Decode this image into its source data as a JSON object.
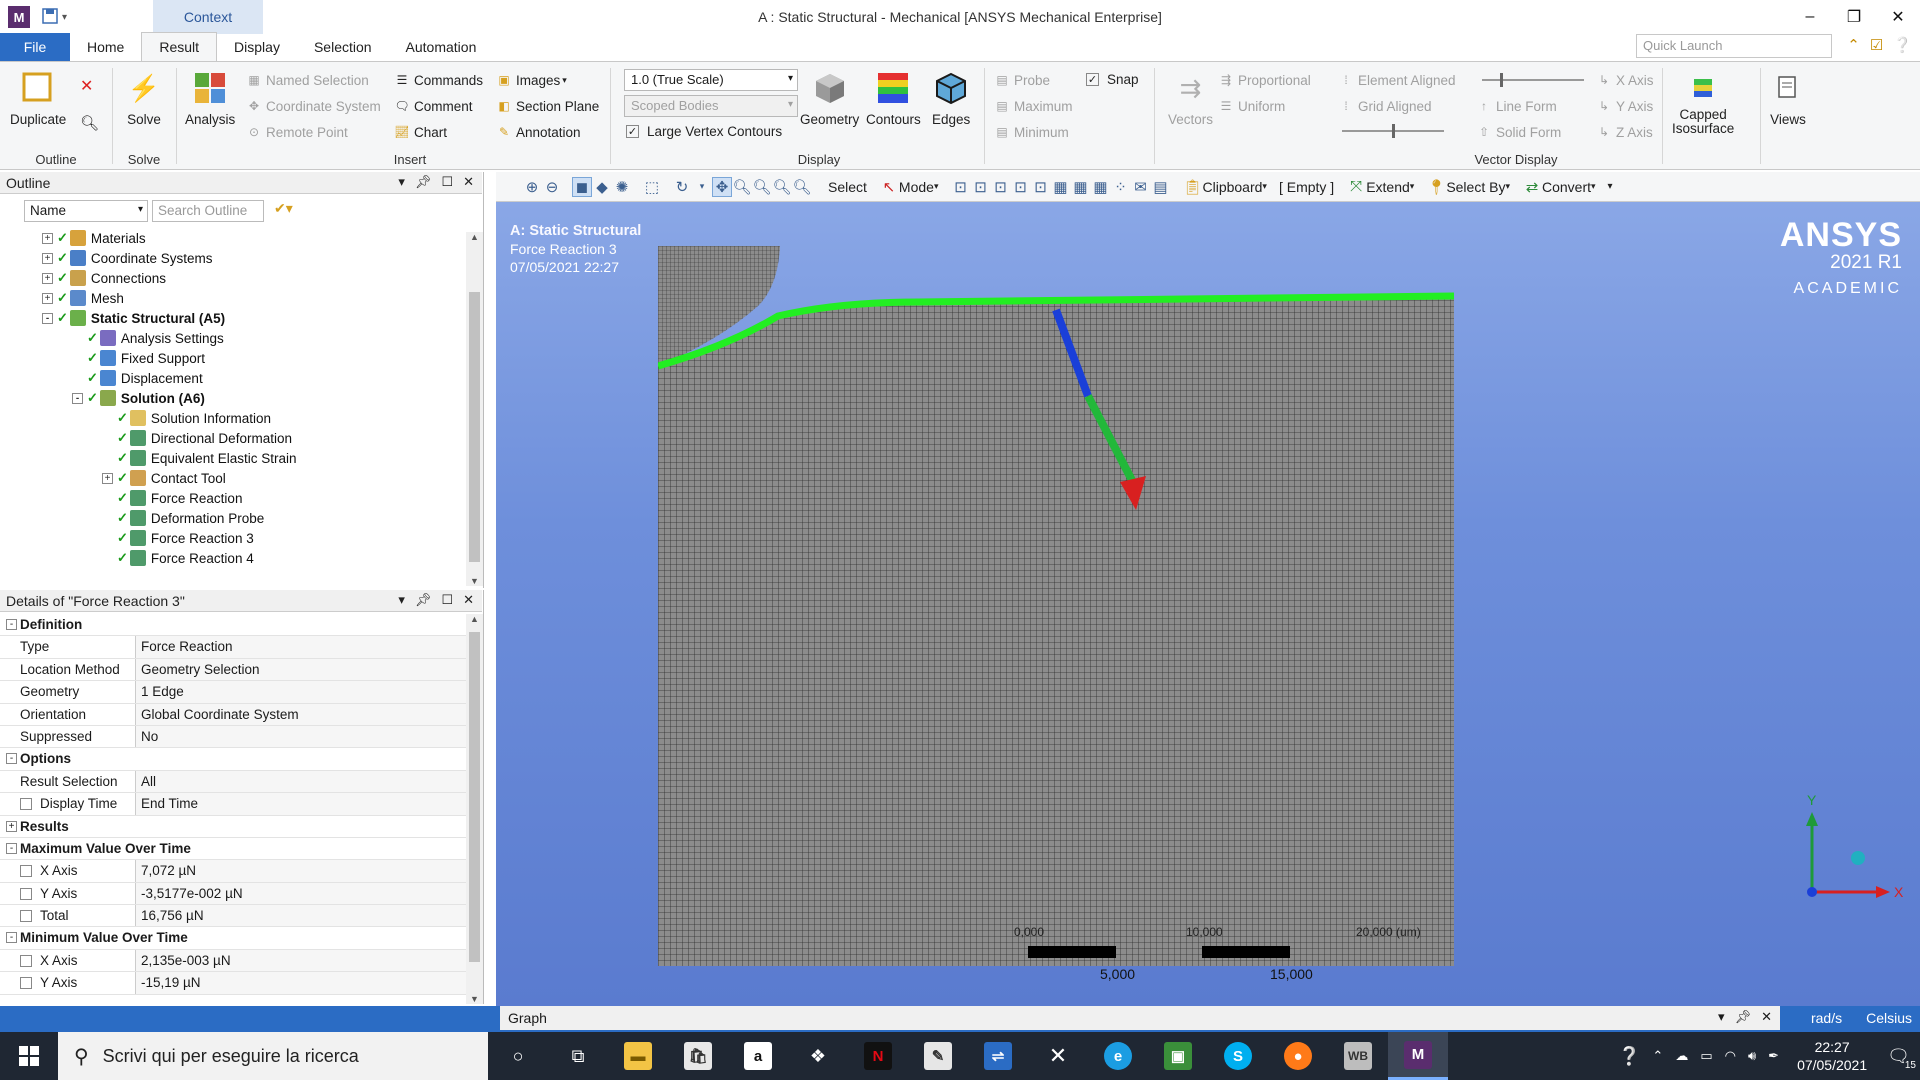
{
  "window": {
    "app_letter": "M",
    "context_tab": "Context",
    "title": "A : Static Structural - Mechanical [ANSYS Mechanical Enterprise]"
  },
  "tabs": [
    "File",
    "Home",
    "Result",
    "Display",
    "Selection",
    "Automation"
  ],
  "active_tab": "Result",
  "quick_launch_placeholder": "Quick Launch",
  "ribbon": {
    "outline": {
      "label": "Outline",
      "duplicate": "Duplicate"
    },
    "solve": {
      "label": "Solve",
      "group": "Solve"
    },
    "analysis": {
      "label": "Analysis"
    },
    "insert": {
      "label": "Insert",
      "named_selection": "Named Selection",
      "coordinate_system": "Coordinate System",
      "remote_point": "Remote Point",
      "commands": "Commands",
      "comment": "Comment",
      "chart": "Chart",
      "images": "Images",
      "section_plane": "Section Plane",
      "annotation": "Annotation"
    },
    "display": {
      "label": "Display",
      "scale": "1.0 (True Scale)",
      "scoped": "Scoped Bodies",
      "large_vertex": "Large Vertex Contours",
      "geometry": "Geometry",
      "contours": "Contours",
      "edges": "Edges",
      "probe": "Probe",
      "maximum": "Maximum",
      "minimum": "Minimum",
      "snap": "Snap"
    },
    "vector_display": {
      "label": "Vector Display",
      "vectors": "Vectors",
      "proportional": "Proportional",
      "uniform": "Uniform",
      "element_aligned": "Element Aligned",
      "grid_aligned": "Grid Aligned",
      "line_form": "Line Form",
      "solid_form": "Solid Form",
      "x_axis": "X Axis",
      "y_axis": "Y Axis",
      "z_axis": "Z Axis"
    },
    "capped_isosurface": "Capped\nIsosurface",
    "views": "Views"
  },
  "outline": {
    "title": "Outline",
    "filter": "Name",
    "search_placeholder": "Search Outline",
    "tree": [
      {
        "label": "Materials",
        "level": 1,
        "expander": "+",
        "icon": "#d7a23c",
        "bold": false
      },
      {
        "label": "Coordinate Systems",
        "level": 1,
        "expander": "+",
        "icon": "#4a7fc7",
        "bold": false
      },
      {
        "label": "Connections",
        "level": 1,
        "expander": "+",
        "icon": "#c9a14c",
        "bold": false
      },
      {
        "label": "Mesh",
        "level": 1,
        "expander": "+",
        "icon": "#5b8acb",
        "bold": false
      },
      {
        "label": "Static Structural (A5)",
        "level": 1,
        "expander": "-",
        "icon": "#6bb04a",
        "bold": true
      },
      {
        "label": "Analysis Settings",
        "level": 2,
        "expander": "",
        "icon": "#7a6cc0",
        "bold": false
      },
      {
        "label": "Fixed Support",
        "level": 2,
        "expander": "",
        "icon": "#4a86d1",
        "bold": false
      },
      {
        "label": "Displacement",
        "level": 2,
        "expander": "",
        "icon": "#4a86d1",
        "bold": false
      },
      {
        "label": "Solution (A6)",
        "level": 2,
        "expander": "-",
        "icon": "#8aa84c",
        "bold": true
      },
      {
        "label": "Solution Information",
        "level": 3,
        "expander": "",
        "icon": "#e0c060",
        "bold": false
      },
      {
        "label": "Directional Deformation",
        "level": 3,
        "expander": "",
        "icon": "#4f9a6a",
        "bold": false
      },
      {
        "label": "Equivalent Elastic Strain",
        "level": 3,
        "expander": "",
        "icon": "#4f9a6a",
        "bold": false
      },
      {
        "label": "Contact Tool",
        "level": 3,
        "expander": "+",
        "icon": "#d0a050",
        "bold": false
      },
      {
        "label": "Force Reaction",
        "level": 3,
        "expander": "",
        "icon": "#4f9a6a",
        "bold": false
      },
      {
        "label": "Deformation Probe",
        "level": 3,
        "expander": "",
        "icon": "#4f9a6a",
        "bold": false
      },
      {
        "label": "Force Reaction 3",
        "level": 3,
        "expander": "",
        "icon": "#4f9a6a",
        "bold": false
      },
      {
        "label": "Force Reaction 4",
        "level": 3,
        "expander": "",
        "icon": "#4f9a6a",
        "bold": false
      }
    ]
  },
  "details": {
    "title": "Details of \"Force Reaction 3\"",
    "rows": [
      {
        "kind": "section",
        "key": "Definition",
        "toggle": "-"
      },
      {
        "kind": "row",
        "key": "Type",
        "value": "Force Reaction",
        "cb": false
      },
      {
        "kind": "row",
        "key": "Location Method",
        "value": "Geometry Selection",
        "cb": false
      },
      {
        "kind": "row",
        "key": "Geometry",
        "value": "1 Edge",
        "cb": false
      },
      {
        "kind": "row",
        "key": "Orientation",
        "value": "Global Coordinate System",
        "cb": false
      },
      {
        "kind": "row",
        "key": "Suppressed",
        "value": "No",
        "cb": false
      },
      {
        "kind": "section",
        "key": "Options",
        "toggle": "-"
      },
      {
        "kind": "row",
        "key": "Result Selection",
        "value": "All",
        "cb": false
      },
      {
        "kind": "row",
        "key": "Display Time",
        "value": "End Time",
        "cb": true
      },
      {
        "kind": "section",
        "key": "Results",
        "toggle": "+"
      },
      {
        "kind": "section",
        "key": "Maximum Value Over Time",
        "toggle": "-"
      },
      {
        "kind": "row",
        "key": "X Axis",
        "value": "7,072 µN",
        "cb": true
      },
      {
        "kind": "row",
        "key": "Y Axis",
        "value": "-3,5177e-002 µN",
        "cb": true
      },
      {
        "kind": "row",
        "key": "Total",
        "value": "16,756 µN",
        "cb": true
      },
      {
        "kind": "section",
        "key": "Minimum Value Over Time",
        "toggle": "-"
      },
      {
        "kind": "row",
        "key": "X Axis",
        "value": "2,135e-003 µN",
        "cb": true
      },
      {
        "kind": "row",
        "key": "Y Axis",
        "value": "-15,19 µN",
        "cb": true
      }
    ]
  },
  "graphics_toolbar": {
    "select": "Select",
    "mode": "Mode",
    "clipboard": "Clipboard",
    "empty": "[ Empty ]",
    "extend": "Extend",
    "select_by": "Select By",
    "convert": "Convert"
  },
  "viewport": {
    "analysis": "A: Static Structural",
    "result": "Force Reaction 3",
    "timestamp": "07/05/2021 22:27",
    "logo_name": "ANSYS",
    "logo_version": "2021 R1",
    "logo_edition": "ACADEMIC",
    "scale_top": [
      "0,000",
      "10,000",
      "20,000 (um)"
    ],
    "scale_bottom": [
      "5,000",
      "15,000"
    ],
    "triad_y": "Y",
    "triad_x": "X",
    "colors": {
      "edge_highlight": "#22ee22",
      "mesh_line": "#2a2a2a",
      "mesh_fill": "#8c8c8c"
    }
  },
  "graph": {
    "title": "Graph"
  },
  "status_units": [
    "rad/s",
    "Celsius"
  ],
  "taskbar": {
    "search_placeholder": "Scrivi qui per eseguire la ricerca",
    "time": "22:27",
    "date": "07/05/2021",
    "notifications": "15"
  }
}
